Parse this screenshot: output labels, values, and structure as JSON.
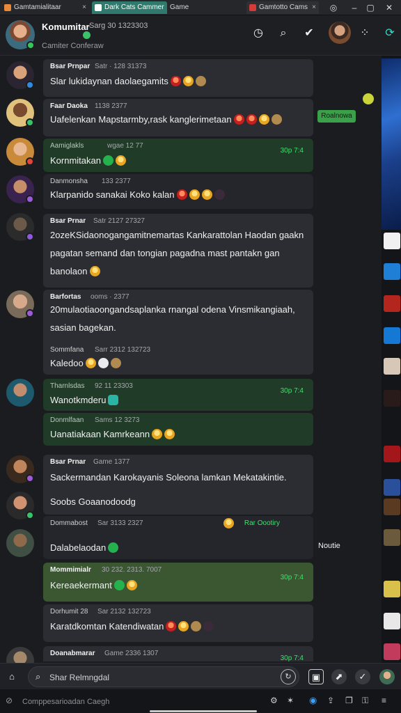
{
  "browser": {
    "tabs": [
      {
        "label": "Gamtamialitaar",
        "close": "×"
      },
      {
        "label": "Dark Cats Cammer"
      },
      {
        "label": "Game"
      },
      {
        "label": "Gamtotto Cams",
        "close": "×"
      }
    ]
  },
  "header": {
    "name": "Komumitar",
    "meta": "Sarg 30 1323303",
    "subtitle": "Camiter Conferaw"
  },
  "messages": [
    {
      "sender": "Bsar Prnpar",
      "time": "Satr · 128  31373",
      "text": "Slar lukidaynan daolaegamits"
    },
    {
      "sender": "Faar Daoka",
      "time": "1138  2377",
      "text": "Uafelenkan Mapstarmby,rask kanglerimetaan"
    },
    {
      "sender": "Aamiglakls",
      "time": "wgae 12 77",
      "text": "Kornmitakan",
      "tag": "30p 7:4"
    },
    {
      "sender": "Danmonsha",
      "time": "133  2377",
      "text": "Klarpanido sanakai Koko kalan"
    },
    {
      "sender": "Bsar Prnar",
      "time": "Satr 2127 27327",
      "text": "2ozeKSidaonogangamitnemartas Kankarattolan Haodan gaakn pagatan semand dan tongian pagadna mast pantakn gan banolaon"
    },
    {
      "sender": "Barfortas",
      "time": "ooms · 2377",
      "text": "20mulaotiaoongandsaplanka rnangal odena Vinsmikangiaah, sasian bagekan."
    },
    {
      "sender": "Sommfana",
      "time": "Sarr 2312 132723",
      "text": "Kaledoo"
    },
    {
      "sender": "Tharnlsdas",
      "time": "92 11 23303",
      "text": "Wanotkmderu",
      "tag": "30p 7:4"
    },
    {
      "sender": "Donmlfaan",
      "time": "Sams 12 3273",
      "text": "Uanatiakaan  Kamrkeann"
    },
    {
      "sender": "Bsar Prnar",
      "time": "Game 1377",
      "text": "Sackermandan  Karokayanis Soleona lamkan  Mekatakintie."
    },
    {
      "sender": "",
      "time": "",
      "text": "Soobs  Goaanodoodg"
    },
    {
      "sender": "Dommabost",
      "time": "Sar 3133 2327",
      "text": "Dalabelaodan",
      "tag": "Rar Oootiry"
    },
    {
      "sender": "Mommimialr",
      "time": "30 232. 2313. 7007",
      "text": "Kereaekermant",
      "tag": "30p 7:4"
    },
    {
      "sender": "Dorhumit 28",
      "time": "Sar 2132 132723",
      "text": "Karatdkomtan  Katendiwatan"
    },
    {
      "sender": "Doanabmarar",
      "time": "Game 2336 1307",
      "text": "",
      "tag": "30p 7:4"
    }
  ],
  "floating": {
    "pill": "Roalnowa",
    "label": "Noutie"
  },
  "input": {
    "placeholder": "Shar Relmngdal"
  },
  "statusbar": {
    "text": "Comppesarioadan Caegh"
  }
}
